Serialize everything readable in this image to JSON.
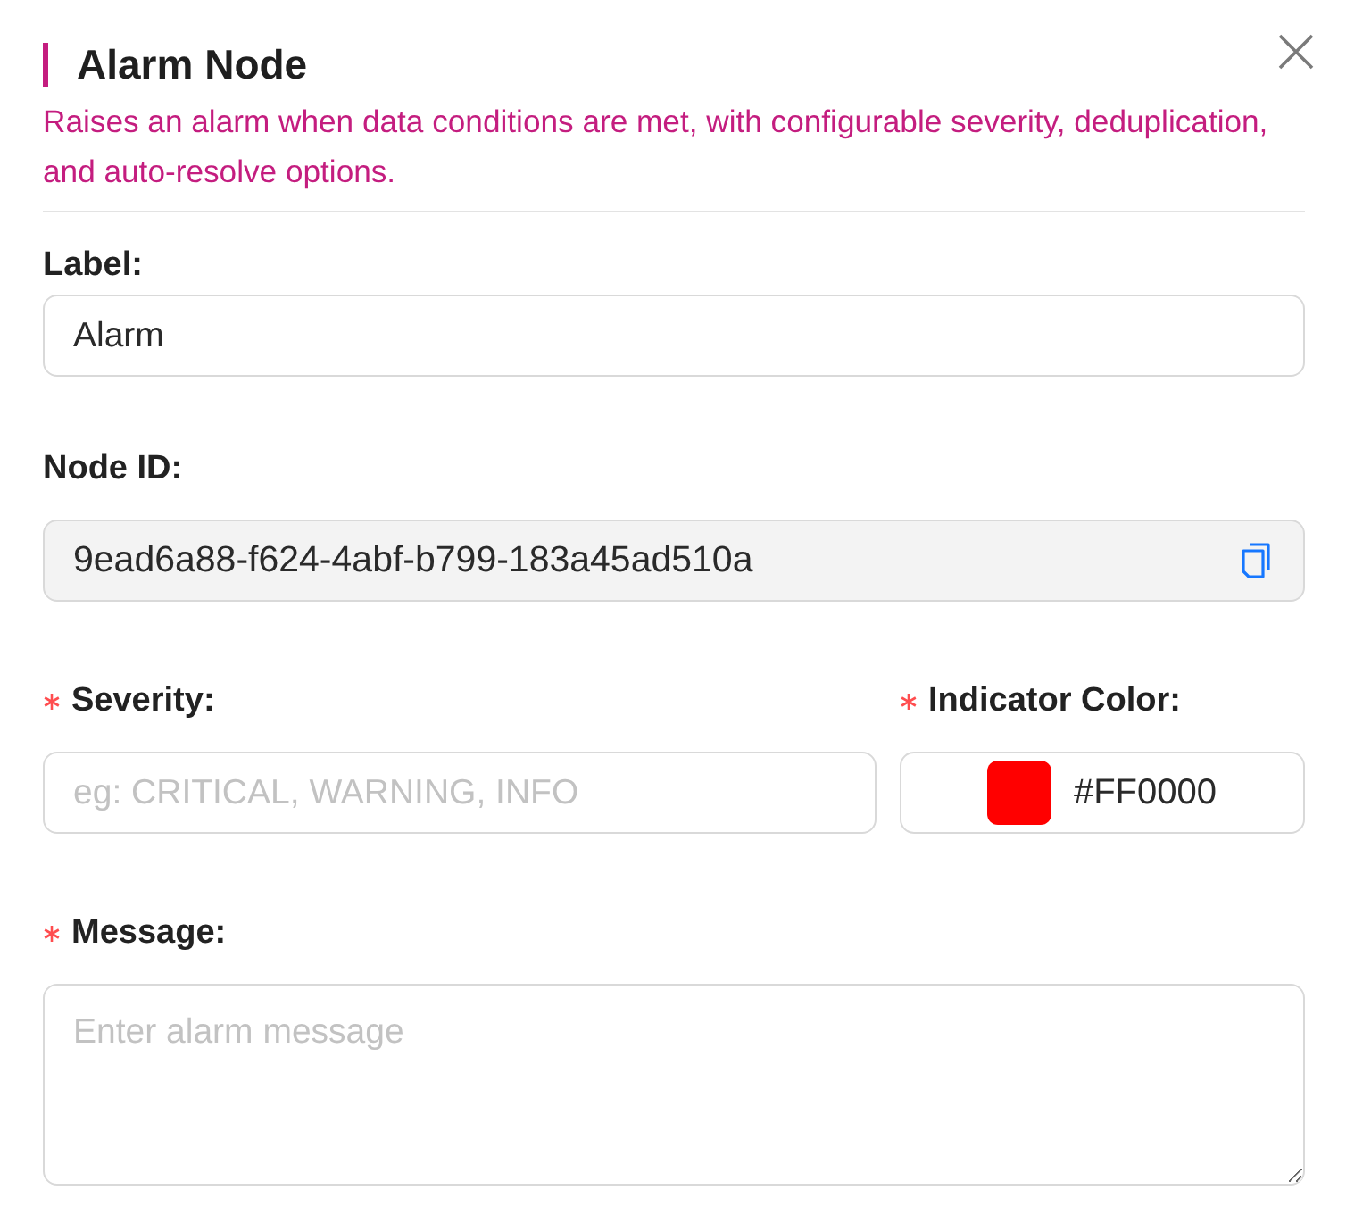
{
  "header": {
    "title": "Alarm Node",
    "description": "Raises an alarm when data conditions are met, with configurable severity, deduplication, and auto-resolve options."
  },
  "rows": [
    {
      "fields": [
        {
          "kind": "text",
          "label": "Label:",
          "required": false,
          "value": "Alarm"
        }
      ]
    },
    {
      "fields": [
        {
          "kind": "copy",
          "label": "Node ID:",
          "required": false,
          "value": "9ead6a88-f624-4abf-b799-183a45ad510a"
        }
      ]
    },
    {
      "fields": [
        {
          "kind": "text",
          "label": "Severity:",
          "required": true,
          "placeholder": "eg: CRITICAL, WARNING, INFO"
        },
        {
          "kind": "color",
          "label": "Indicator Color:",
          "required": true,
          "value": "#FF0000"
        }
      ]
    },
    {
      "fields": [
        {
          "kind": "textarea",
          "label": "Message:",
          "required": true,
          "placeholder": "Enter alarm message"
        }
      ]
    }
  ]
}
